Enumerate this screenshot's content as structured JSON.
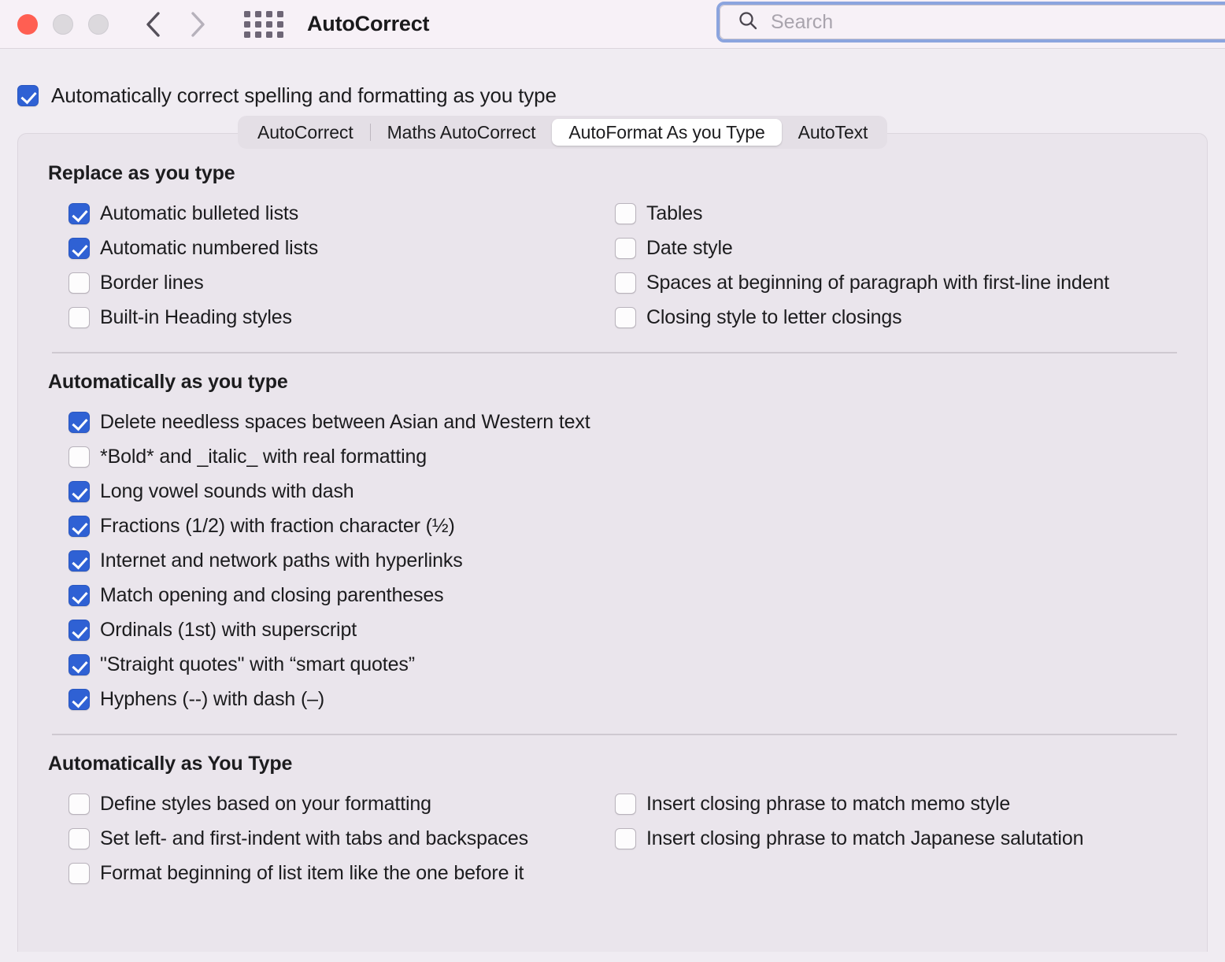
{
  "window": {
    "title": "AutoCorrect",
    "traffic_lights": [
      "close",
      "minimize",
      "zoom"
    ],
    "back_label": "Back",
    "forward_label": "Forward",
    "grid_label": "Show All"
  },
  "search": {
    "placeholder": "Search",
    "value": "",
    "icon": "search-icon",
    "focus_ring_color": "#8ba4de"
  },
  "master_toggle": {
    "label": "Automatically correct spelling and formatting as you type",
    "checked": true
  },
  "tabs": [
    {
      "label": "AutoCorrect",
      "selected": false
    },
    {
      "label": "Maths AutoCorrect",
      "selected": false
    },
    {
      "label": "AutoFormat As you Type",
      "selected": true
    },
    {
      "label": "AutoText",
      "selected": false
    }
  ],
  "sections": [
    {
      "title": "Replace as you type",
      "left": [
        {
          "label": "Automatic bulleted lists",
          "checked": true
        },
        {
          "label": "Automatic numbered lists",
          "checked": true
        },
        {
          "label": "Border lines",
          "checked": false
        },
        {
          "label": "Built-in Heading styles",
          "checked": false
        }
      ],
      "right": [
        {
          "label": "Tables",
          "checked": false
        },
        {
          "label": "Date style",
          "checked": false
        },
        {
          "label": "Spaces at beginning of paragraph with first-line indent",
          "checked": false
        },
        {
          "label": "Closing style to letter closings",
          "checked": false
        }
      ]
    },
    {
      "title": "Automatically as you type",
      "left": [
        {
          "label": "Delete needless spaces between Asian and Western text",
          "checked": true
        },
        {
          "label": "*Bold* and _italic_ with real formatting",
          "checked": false
        },
        {
          "label": "Long vowel sounds with dash",
          "checked": true
        },
        {
          "label": "Fractions (1/2) with fraction character (½)",
          "checked": true
        },
        {
          "label": "Internet and network paths with hyperlinks",
          "checked": true
        },
        {
          "label": "Match opening and closing parentheses",
          "checked": true
        },
        {
          "label": "Ordinals (1st) with superscript",
          "checked": true
        },
        {
          "label": "\"Straight quotes\" with “smart quotes”",
          "checked": true
        },
        {
          "label": "Hyphens (--) with dash (–)",
          "checked": true
        }
      ],
      "right": []
    },
    {
      "title": "Automatically as You Type",
      "left": [
        {
          "label": "Define styles based on your formatting",
          "checked": false
        },
        {
          "label": "Set left- and first-indent with tabs and backspaces",
          "checked": false
        },
        {
          "label": "Format beginning of list item like the one before it",
          "checked": false
        }
      ],
      "right": [
        {
          "label": "Insert closing phrase to match memo style",
          "checked": false
        },
        {
          "label": "Insert closing phrase to match Japanese salutation",
          "checked": false
        }
      ]
    }
  ],
  "colors": {
    "accent": "#2f61d4",
    "toolbar_bg": "#f7f1f7",
    "body_bg": "#f0ecf2",
    "panel_bg": "#eae5ec",
    "close_button": "#ff5f52"
  }
}
